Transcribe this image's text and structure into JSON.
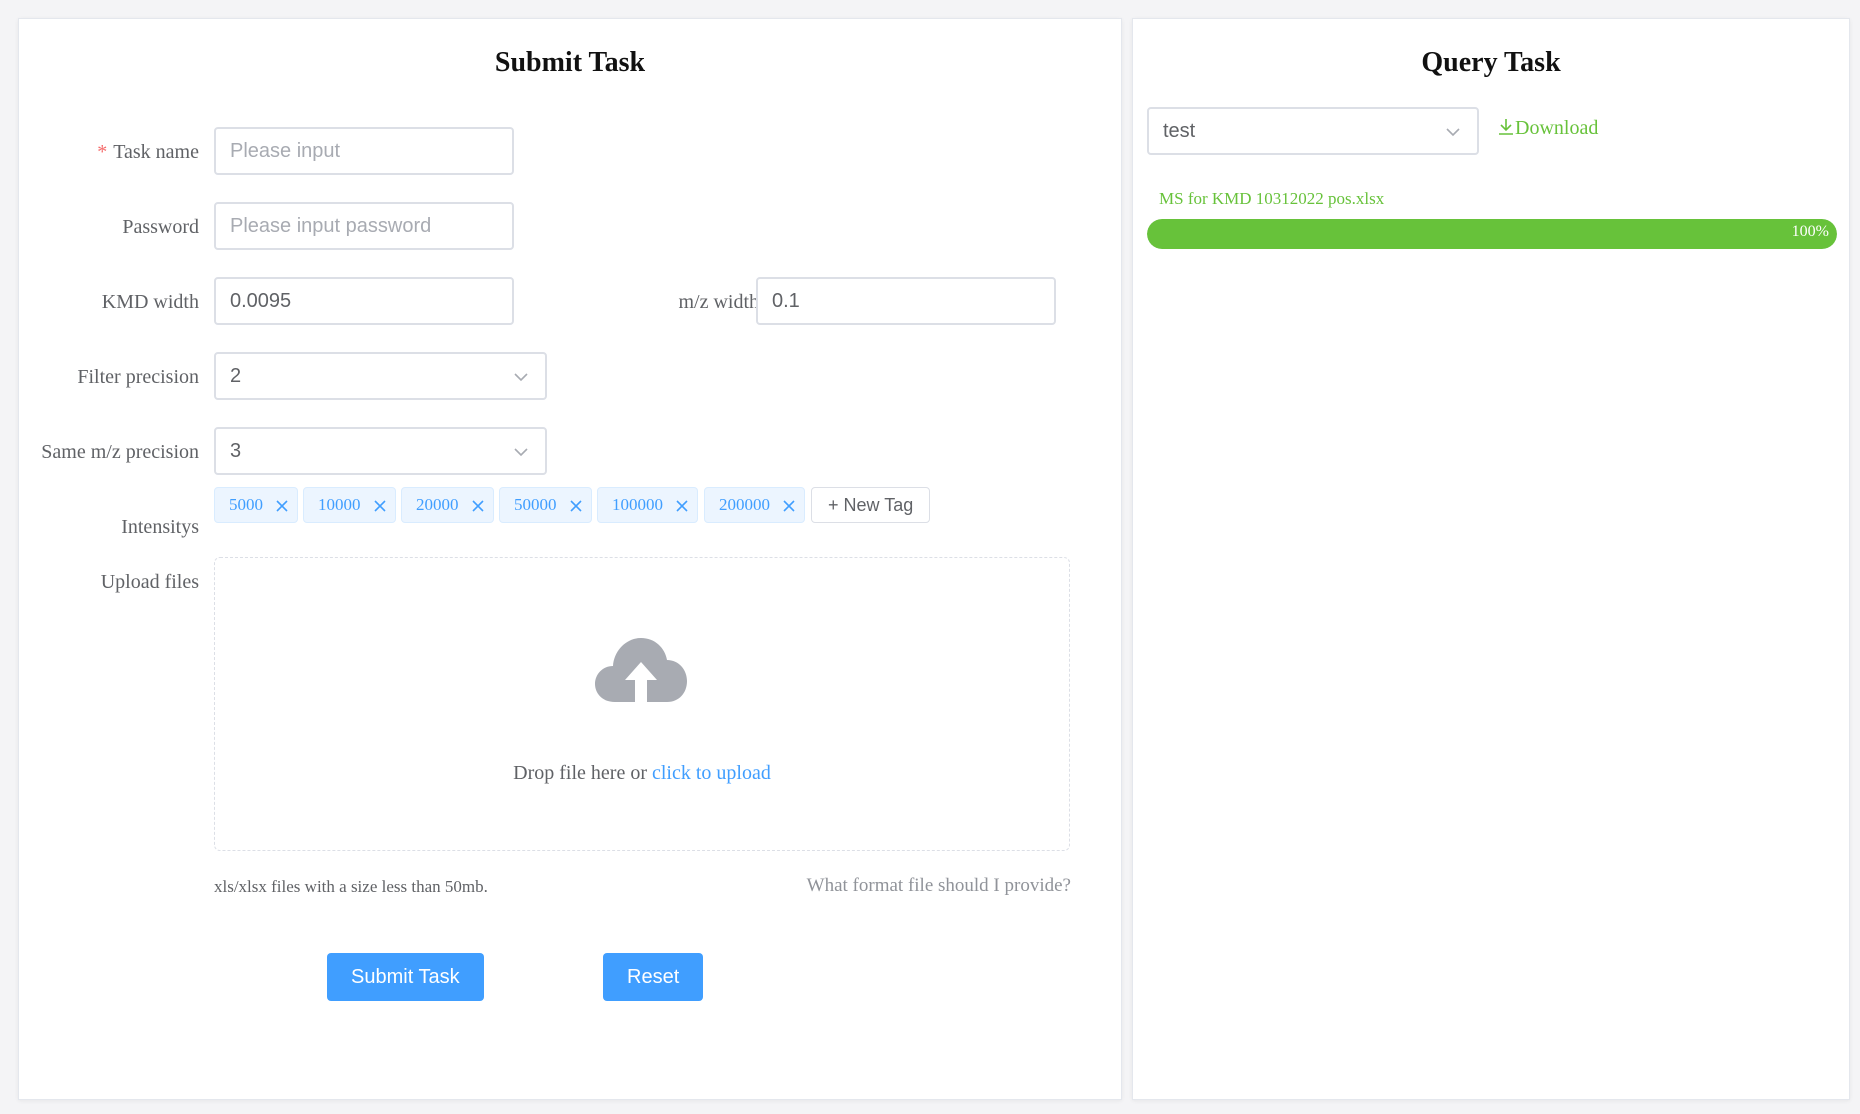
{
  "submit": {
    "title": "Submit Task",
    "task_name": {
      "label": "Task name",
      "placeholder": "Please input",
      "value": ""
    },
    "password": {
      "label": "Password",
      "placeholder": "Please input password",
      "value": ""
    },
    "kmd_width": {
      "label": "KMD width",
      "value": "0.0095"
    },
    "mz_width": {
      "label": "m/z width",
      "value": "0.1"
    },
    "filter_precision": {
      "label": "Filter precision",
      "value": "2"
    },
    "same_mz_precision": {
      "label": "Same m/z precision",
      "value": "3"
    },
    "intensities": {
      "label": "Intensitys",
      "tags": [
        "5000",
        "10000",
        "20000",
        "50000",
        "100000",
        "200000"
      ],
      "new_tag_label": "+ New Tag"
    },
    "upload": {
      "label": "Upload files",
      "drop_text": "Drop file here or ",
      "link_text": "click to upload",
      "tip": "xls/xlsx files with a size less than 50mb.",
      "format_help": "What format file should I provide?"
    },
    "submit_button": "Submit Task",
    "reset_button": "Reset"
  },
  "query": {
    "title": "Query Task",
    "selected_task": "test",
    "download_label": "Download",
    "file": {
      "name": "MS for KMD 10312022 pos.xlsx",
      "progress": 100,
      "progress_text": "100%"
    }
  },
  "colors": {
    "primary": "#409eff",
    "success": "#67c23a",
    "danger": "#f56c6c",
    "tag_bg": "#ecf5ff"
  }
}
